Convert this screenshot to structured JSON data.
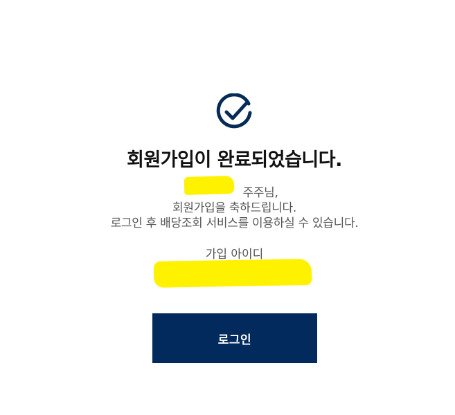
{
  "icon": {
    "name": "check-circle-icon",
    "color": "#062b57"
  },
  "title": "회원가입이 완료되었습니다.",
  "message": {
    "line1_suffix": " 주주님,",
    "line2": "회원가입을 축하드립니다.",
    "line3": "로그인 후 배당조회 서비스를 이용하실 수 있습니다."
  },
  "id_section": {
    "label": "가입 아이디"
  },
  "login_button": {
    "label": "로그인",
    "color": "#022a5c"
  }
}
